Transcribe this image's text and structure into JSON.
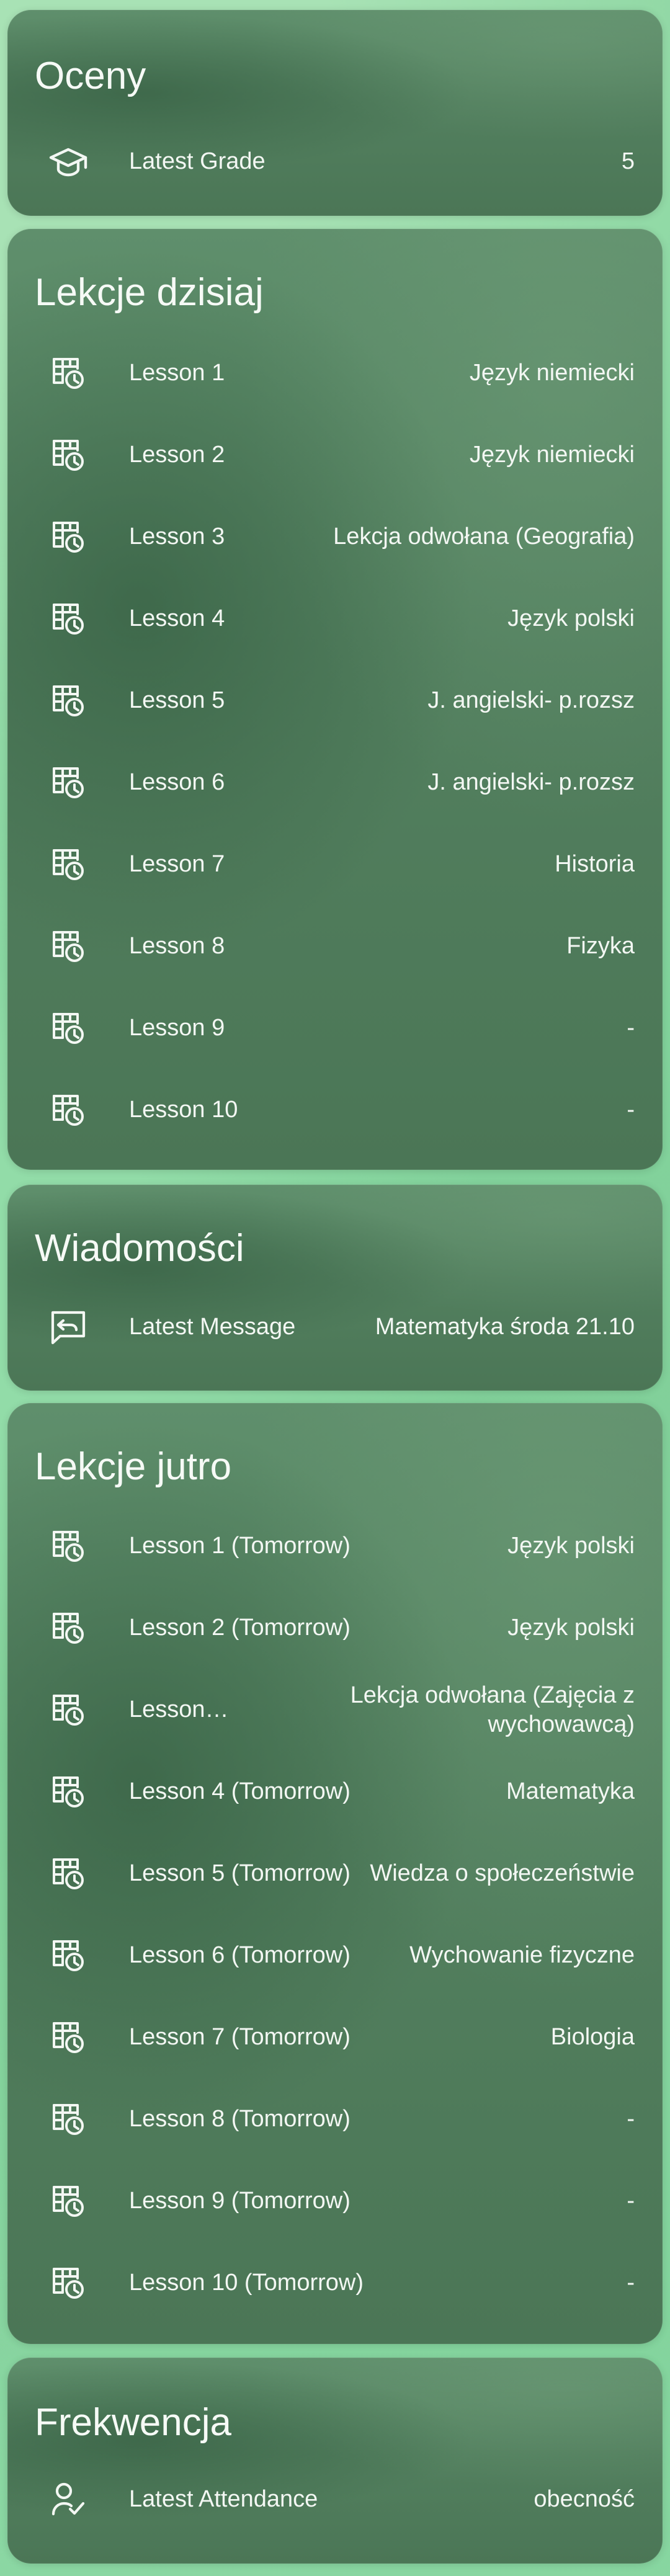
{
  "grades": {
    "title": "Oceny",
    "label": "Latest Grade",
    "value": "5",
    "icon": "school-icon"
  },
  "today": {
    "title": "Lekcje dzisiaj",
    "items": [
      {
        "label": "Lesson 1",
        "value": "Język niemiecki"
      },
      {
        "label": "Lesson 2",
        "value": "Język niemiecki"
      },
      {
        "label": "Lesson 3",
        "value": "Lekcja odwołana (Geografia)"
      },
      {
        "label": "Lesson 4",
        "value": "Język polski"
      },
      {
        "label": "Lesson 5",
        "value": "J. angielski- p.rozsz"
      },
      {
        "label": "Lesson 6",
        "value": "J. angielski- p.rozsz"
      },
      {
        "label": "Lesson 7",
        "value": "Historia"
      },
      {
        "label": "Lesson 8",
        "value": "Fizyka"
      },
      {
        "label": "Lesson 9",
        "value": "-"
      },
      {
        "label": "Lesson 10",
        "value": "-"
      }
    ]
  },
  "messages": {
    "title": "Wiadomości",
    "label": "Latest Message",
    "value": "Matematyka środa 21.10",
    "icon": "message-reply-icon"
  },
  "tomorrow": {
    "title": "Lekcje jutro",
    "items": [
      {
        "label": "Lesson 1 (Tomorrow)",
        "value": "Język polski"
      },
      {
        "label": "Lesson 2 (Tomorrow)",
        "value": "Język polski"
      },
      {
        "label": "Lesson …",
        "value": "Lekcja odwołana (Zajęcia z wychowawcą)"
      },
      {
        "label": "Lesson 4 (Tomorrow)",
        "value": "Matematyka"
      },
      {
        "label": "Lesson 5 (Tomorrow)",
        "value": "Wiedza o społeczeństwie"
      },
      {
        "label": "Lesson 6 (Tomorrow)",
        "value": "Wychowanie fizyczne"
      },
      {
        "label": "Lesson 7 (Tomorrow)",
        "value": "Biologia"
      },
      {
        "label": "Lesson 8 (Tomorrow)",
        "value": "-"
      },
      {
        "label": "Lesson 9 (Tomorrow)",
        "value": "-"
      },
      {
        "label": "Lesson 10 (Tomorrow)",
        "value": "-"
      }
    ]
  },
  "attendance": {
    "title": "Frekwencja",
    "label": "Latest Attendance",
    "value": "obecność",
    "icon": "user-check-icon"
  },
  "colors": {
    "background": "#85d39e",
    "card": "#588666",
    "text": "#f4f8f4"
  }
}
